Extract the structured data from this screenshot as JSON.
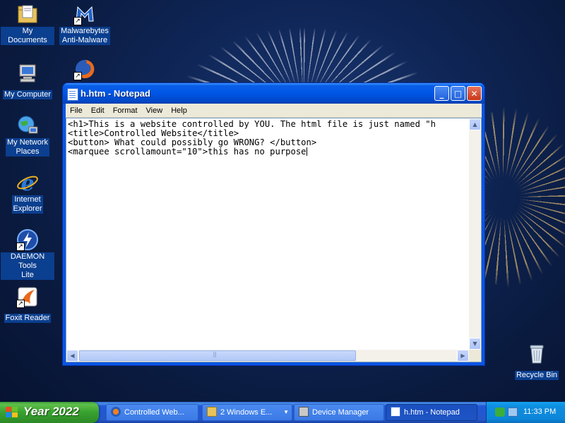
{
  "desktop": {
    "icons": [
      {
        "label": "My Documents",
        "icon": "folder-documents-icon"
      },
      {
        "label": "Malwarebytes Anti-Malware",
        "line1": "Malwarebytes",
        "line2": "Anti-Malware",
        "icon": "malwarebytes-icon"
      },
      {
        "label": "My Computer",
        "icon": "computer-icon"
      },
      {
        "label": "Firefox",
        "icon": "firefox-icon"
      },
      {
        "label": "My Network Places",
        "line1": "My Network",
        "line2": "Places",
        "icon": "network-icon"
      },
      {
        "label": "Internet Explorer",
        "line1": "Internet",
        "line2": "Explorer",
        "icon": "internet-explorer-icon"
      },
      {
        "label": "DAEMON Tools Lite",
        "line1": "DAEMON Tools",
        "line2": "Lite",
        "icon": "daemon-tools-icon"
      },
      {
        "label": "Foxit Reader",
        "icon": "foxit-reader-icon"
      },
      {
        "label": "Recycle Bin",
        "icon": "recycle-bin-icon"
      }
    ]
  },
  "notepad": {
    "title": "h.htm - Notepad",
    "menu": [
      "File",
      "Edit",
      "Format",
      "View",
      "Help"
    ],
    "lines": [
      "<h1>This is a website controlled by YOU. The html file is just named \"h",
      "<title>Controlled Website</title>",
      "<button> What could possibly go WRONG? </button>",
      "<marquee scrollamount=\"10\">this has no purpose"
    ]
  },
  "taskbar": {
    "start_label": "Year 2022",
    "tasks": [
      {
        "label": "Controlled Web...",
        "icon": "browser-icon",
        "active": false
      },
      {
        "label": "2 Windows E...",
        "icon": "folder-icon",
        "active": false
      },
      {
        "label": "Device Manager",
        "icon": "device-manager-icon",
        "active": false
      },
      {
        "label": "h.htm - Notepad",
        "icon": "notepad-icon",
        "active": true
      }
    ],
    "clock": "11:33 PM"
  }
}
